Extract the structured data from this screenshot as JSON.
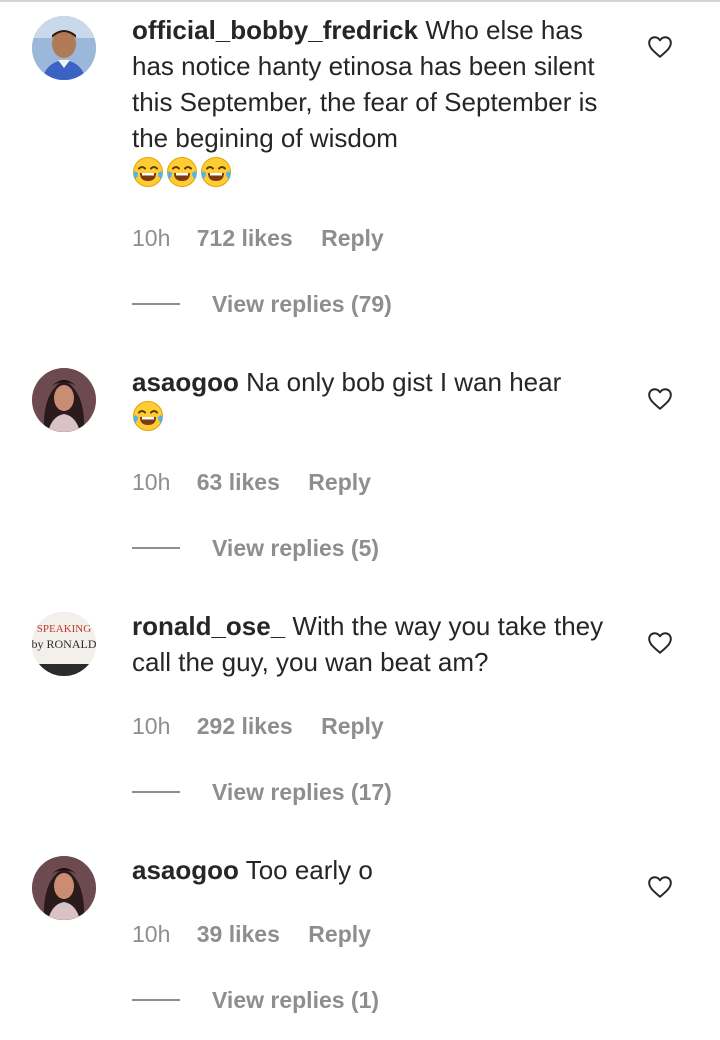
{
  "comments": [
    {
      "username": "official_bobby_fredrick",
      "text": "Who else has has notice hanty etinosa has been silent this September, the fear of September is the begining of wisdom",
      "emojis": [
        "face-with-tears-of-joy",
        "face-with-tears-of-joy",
        "face-with-tears-of-joy"
      ],
      "time": "10h",
      "likes": "712 likes",
      "reply_label": "Reply",
      "view_replies": "View replies (79)",
      "avatar": "man-portrait"
    },
    {
      "username": "asaogoo",
      "text": "Na only bob gist I wan hear",
      "emojis": [
        "face-with-tears-of-joy"
      ],
      "time": "10h",
      "likes": "63 likes",
      "reply_label": "Reply",
      "view_replies": "View replies (5)",
      "avatar": "woman-portrait"
    },
    {
      "username": "ronald_ose_",
      "text": "With the way you take they call the guy, you wan beat am?",
      "emojis": [],
      "time": "10h",
      "likes": "292 likes",
      "reply_label": "Reply",
      "view_replies": "View replies (17)",
      "avatar": "speaking-by-ronald-logo",
      "avatar_text": [
        "SPEAKING",
        "by RONALD"
      ]
    },
    {
      "username": "asaogoo",
      "text": "Too early o",
      "emojis": [],
      "time": "10h",
      "likes": "39 likes",
      "reply_label": "Reply",
      "view_replies": "View replies (1)",
      "avatar": "woman-portrait"
    }
  ],
  "colors": {
    "text": "#262626",
    "secondary": "#8e8e8e",
    "background": "#ffffff"
  },
  "icons": {
    "like": "heart-outline-icon",
    "emoji": "face-with-tears-of-joy"
  }
}
